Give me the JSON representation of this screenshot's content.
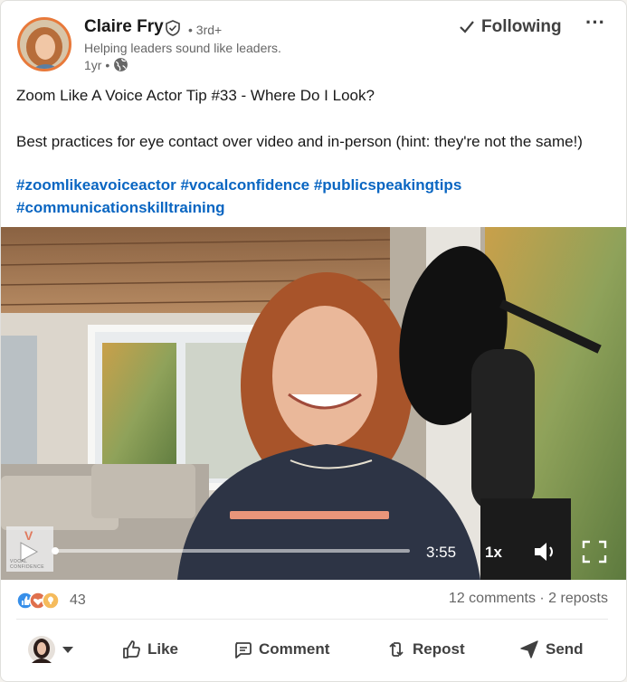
{
  "post": {
    "author": {
      "name": "Claire Fry",
      "degree": "• 3rd+",
      "headline": "Helping leaders sound like leaders.",
      "time": "1yr •",
      "verified_icon": "verified-shield-icon",
      "visibility_icon": "globe-icon"
    },
    "follow_label": "Following",
    "more_label": "···",
    "text": {
      "line1": "Zoom Like A Voice Actor Tip #33 - Where Do I Look?",
      "line2": "Best practices for eye contact over video and in-person (hint: they're not the same!)"
    },
    "hashtags": [
      "#zoomlikeavoiceactor",
      "#vocalconfidence",
      "#publicspeakingtips",
      "#communicationskilltraining"
    ],
    "video": {
      "duration": "3:55",
      "speed": "1x",
      "watermark_letter": "V",
      "watermark_text": "VOCAL CONFIDENCE",
      "progress": 0.0
    },
    "social": {
      "reaction_count": "43",
      "reaction_icons": [
        "like-icon",
        "love-icon",
        "insightful-icon"
      ],
      "counts_text": "12 comments · 2 reposts"
    },
    "actions": [
      {
        "label": "Like",
        "icon": "thumbs-up-icon"
      },
      {
        "label": "Comment",
        "icon": "comment-icon"
      },
      {
        "label": "Repost",
        "icon": "repost-icon"
      },
      {
        "label": "Send",
        "icon": "send-icon"
      }
    ]
  },
  "colors": {
    "accent": "#0a66c2",
    "avatar_ring": "#e8793a",
    "text": "#191919",
    "muted": "#666666"
  }
}
